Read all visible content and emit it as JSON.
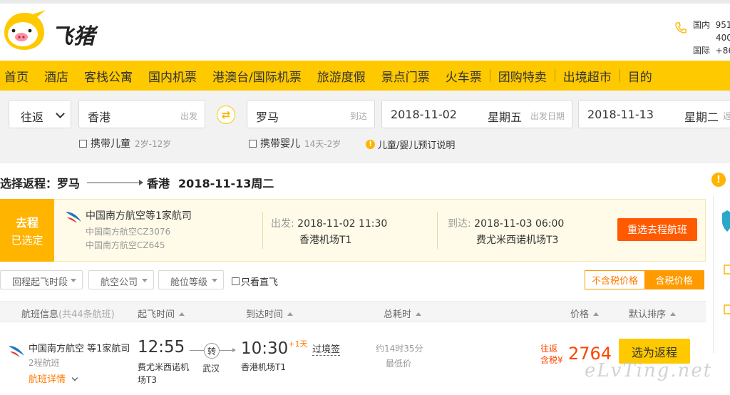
{
  "header": {
    "logo_text": "飞猪",
    "contact": {
      "domestic_label": "国内",
      "domestic_num1": "951",
      "domestic_num2": "400",
      "intl_label": "国际",
      "intl_num": "+86"
    }
  },
  "nav": {
    "items": [
      "首页",
      "酒店",
      "客栈公寓",
      "国内机票",
      "港澳台/国际机票",
      "旅游度假",
      "景点门票",
      "火车票",
      "团购特卖",
      "出境超市",
      "目的"
    ]
  },
  "search": {
    "trip_type": "往返",
    "from_city": "香港",
    "from_hint": "出发",
    "to_city": "罗马",
    "to_hint": "到达",
    "depart_date": "2018-11-02",
    "depart_weekday": "星期五",
    "depart_hint": "出发日期",
    "return_date": "2018-11-13",
    "return_weekday": "星期二",
    "return_hint": "返",
    "swap_icon": "⇄",
    "child_label": "携带儿童",
    "child_sub": "2岁-12岁",
    "infant_label": "携带婴儿",
    "infant_sub": "14天-2岁",
    "info_icon": "!",
    "booking_note": "儿童/婴儿预订说明"
  },
  "return_header": {
    "prefix": "选择返程：",
    "from": "罗马",
    "to": "香港",
    "date": "2018-11-13周二"
  },
  "outbound": {
    "badge_top": "去程",
    "badge_bottom": "已选定",
    "airline": "中国南方航空等1家航司",
    "flight1": "中国南方航空CZ3076",
    "flight2": "中国南方航空CZ645",
    "depart_label": "出发:",
    "depart_time": "2018-11-02 11:30",
    "depart_airport": "香港机场T1",
    "arrive_label": "到达:",
    "arrive_time": "2018-11-03 06:00",
    "arrive_airport": "费尤米西诺机场T3",
    "reselect_button": "重选去程航班"
  },
  "filters": {
    "depart_period": "回程起飞时段",
    "airline": "航空公司",
    "cabin": "舱位等级",
    "direct_only": "只看直飞",
    "price_excl_tax": "不含税价格",
    "price_incl_tax": "含税价格"
  },
  "table_header": {
    "flight_info": "航班信息",
    "flight_count": "(共44条航班)",
    "depart_time": "起飞时间",
    "arrive_time": "到达时间",
    "duration": "总耗时",
    "price": "价格",
    "sort": "默认排序"
  },
  "flights": [
    {
      "airline": "中国南方航空 等1家航司",
      "legs": "2程航班",
      "details_link": "航班详情",
      "depart_time": "12:55",
      "depart_airport": "费尤米西诺机场T3",
      "stop_label": "转",
      "stop_city": "武汉",
      "arrive_time": "10:30",
      "day_plus": "+1天",
      "transit_visa": "过境签",
      "arrive_airport": "香港机场T1",
      "duration": "约14时35分",
      "duration_note": "最低价",
      "price_label_top": "往返",
      "price_label_bottom": "含税",
      "currency": "¥",
      "price": "2764",
      "book_button": "选为返程"
    }
  ],
  "watermark": "eLvTing.net"
}
